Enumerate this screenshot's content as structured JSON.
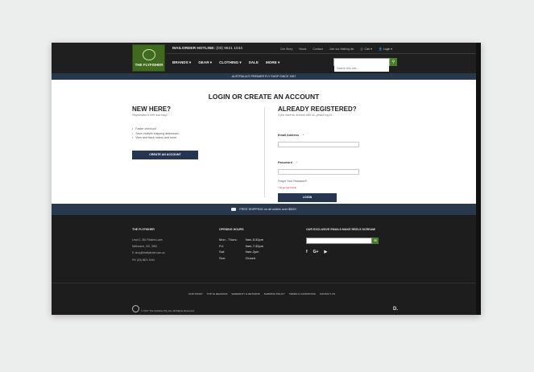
{
  "header": {
    "logo_text": "THE FLYFISHER",
    "hotline_label": "MAILORDER HOTLINE:",
    "hotline_number": "(03) 9621 1044",
    "top_links": [
      "Our Story",
      "News",
      "Contact",
      "Join our Mailing list"
    ],
    "cart_label": "Cart",
    "login_label": "Login",
    "nav": [
      "BRANDS ▾",
      "GEAR ▾",
      "CLOTHING ▾",
      "SALE",
      "MORE ▾"
    ],
    "search_placeholder": "Search this site...",
    "search_icon": "search-icon"
  },
  "banner": "AUSTRALIA'S PREMIER FLY SHOP SINCE 1967",
  "main_title": "LOGIN OR CREATE AN ACCOUNT",
  "new_here": {
    "title": "NEW HERE?",
    "subtitle": "Registration is free and easy!",
    "bullets": [
      "Faster checkout",
      "Save multiple shipping addresses",
      "View and track orders and more"
    ],
    "button": "CREATE AN ACCOUNT"
  },
  "registered": {
    "title": "ALREADY REGISTERED?",
    "subtitle": "If you have an account with us, please log in.",
    "email_label": "Email Address",
    "password_label": "Password",
    "required_star": "*",
    "forgot": "Forgot Your Password?",
    "required_note": "* Required Fields",
    "button": "LOGIN"
  },
  "shipping_bar": "FREE SHIPPING on all orders over $500!",
  "footer": {
    "col1_title": "THE FLYFISHER",
    "col1_lines": [
      "Level 2, 381 Flinders Lane,",
      "Melbourne, VIC, 3000",
      "E: shop@theflyfisher.com.au",
      "PH: (03) 9621 1044"
    ],
    "col2_title": "OPENING HOURS",
    "hours": [
      {
        "day": "Mon - Thurs:",
        "time": "9am-5:30pm"
      },
      {
        "day": "Fri:",
        "time": "9am-7:30pm"
      },
      {
        "day": "Sat:",
        "time": "9am-2pm"
      },
      {
        "day": "Sun:",
        "time": "Closed"
      }
    ],
    "col3_title": "OUR EXCLUSIVE EMAILS MAKE REELS SCREAM!",
    "social": [
      "f",
      "G+",
      "▶"
    ],
    "links": [
      "OUR STORY",
      "TOP 10 REASONS",
      "WARRANTY & RETURNS",
      "SHIPPING POLICY",
      "TERMS & CONDITIONS",
      "CONTACT US"
    ],
    "copyright": "© 2017 The Flyfisher Pty Ltd. All Rights Reserved.",
    "badge": "D."
  }
}
